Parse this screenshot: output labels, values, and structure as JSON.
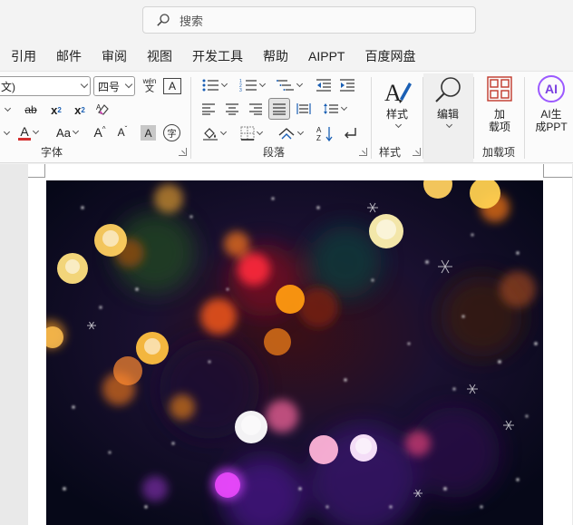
{
  "search": {
    "label": "搜索"
  },
  "menu": [
    "引用",
    "邮件",
    "审阅",
    "视图",
    "开发工具",
    "帮助",
    "AIPPT",
    "百度网盘"
  ],
  "font": {
    "name_value": "文)",
    "size_value": "四号",
    "phonetic_top": "wén",
    "phonetic_bottom": "文",
    "char_border": "A",
    "strike_label": "ab",
    "sub_label": "x",
    "sub_small": "2",
    "sup_label": "x",
    "sup_small": "2",
    "color_label": "A",
    "case_label": "Aa",
    "grow_label": "A",
    "shrink_label": "A",
    "shade_label": "A",
    "enclose_label": "字",
    "group_label": "字体"
  },
  "paragraph": {
    "group_label": "段落"
  },
  "styles": {
    "button_label": "样式",
    "group_label": "样式"
  },
  "editing": {
    "button_label": "编辑"
  },
  "addins": {
    "button_line1": "加",
    "button_line2": "载项",
    "group_label": "加载项"
  },
  "ai": {
    "icon_text": "AI",
    "button_line1": "AI生",
    "button_line2": "成PPT"
  },
  "colors": {
    "accent_red": "#c0392b",
    "ai_purple": "#7a3fe0",
    "font_color_bar": "#d32f2f"
  }
}
